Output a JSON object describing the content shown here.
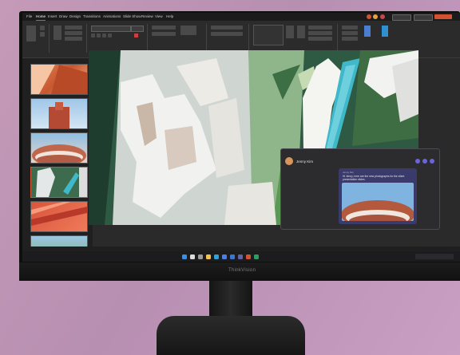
{
  "device": {
    "brand": "ThinkVision"
  },
  "app": {
    "menus": [
      "File",
      "Home",
      "Insert",
      "Draw",
      "Design",
      "Transitions",
      "Animations",
      "Slide Show",
      "Review",
      "View",
      "Help"
    ],
    "active_menu": "Home"
  },
  "chat": {
    "sender": "Jenny Kim",
    "message": "Hi Jenny, here are the new photographs for the client presentation slides."
  },
  "colors": {
    "accent": "#d35230",
    "pool": "#3fb8c9",
    "chat_bubble": "#3b3b6b"
  },
  "icons": [
    "start-icon",
    "search-icon",
    "taskview-icon",
    "explorer-icon",
    "edge-icon",
    "store-icon",
    "mail-icon",
    "teams-icon",
    "powerpoint-icon",
    "photos-icon"
  ]
}
